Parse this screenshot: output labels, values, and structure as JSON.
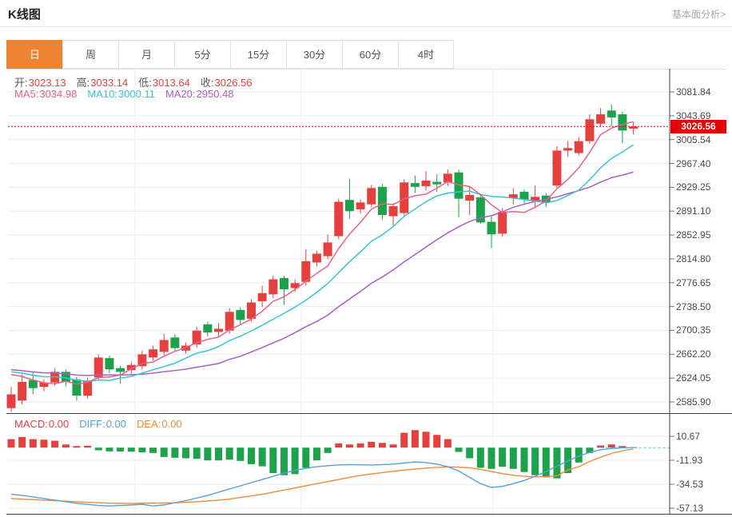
{
  "header": {
    "title": "K线图",
    "link": "基本面分析>"
  },
  "tabs": [
    {
      "label": "日",
      "active": true
    },
    {
      "label": "周",
      "active": false
    },
    {
      "label": "月",
      "active": false
    },
    {
      "label": "5分",
      "active": false
    },
    {
      "label": "15分",
      "active": false
    },
    {
      "label": "30分",
      "active": false
    },
    {
      "label": "60分",
      "active": false
    },
    {
      "label": "4时",
      "active": false
    }
  ],
  "ohlc_legend": [
    {
      "label": "开:",
      "value": "3023.13"
    },
    {
      "label": "高:",
      "value": "3033.14"
    },
    {
      "label": "低:",
      "value": "3013.64"
    },
    {
      "label": "收:",
      "value": "3026.56"
    }
  ],
  "ma_legend": [
    {
      "label": "MA5:",
      "value": "3034.98",
      "color_key": "ma5"
    },
    {
      "label": "MA10:",
      "value": "3000.11",
      "color_key": "ma10"
    },
    {
      "label": "MA20:",
      "value": "2950.48",
      "color_key": "ma20"
    }
  ],
  "macd_legend": [
    {
      "label": "MACD:",
      "value": "0.00",
      "color_key": "up"
    },
    {
      "label": "DIFF:",
      "value": "0.00",
      "color_key": "diff"
    },
    {
      "label": "DEA:",
      "value": "0.00",
      "color_key": "dea"
    }
  ],
  "colors": {
    "up": "#e6403e",
    "down": "#1ba24a",
    "ma5": "#ec5f86",
    "ma10": "#36c6d2",
    "ma20": "#a95fc5",
    "diff": "#57a0d9",
    "dea": "#ec8b3f",
    "badge": "#e60000",
    "tab_active": "#ee8333",
    "grid": "#ececec",
    "frame": "#3f3f3f",
    "tick": "#777777"
  },
  "chart_data": {
    "type": "candlestick",
    "title": "K线图 (日K)",
    "price_axis_labels": [
      "3081.84",
      "3043.69",
      "3005.54",
      "2967.40",
      "2929.25",
      "2891.10",
      "2852.95",
      "2814.80",
      "2776.65",
      "2738.50",
      "2700.35",
      "2662.20",
      "2624.05",
      "2585.90"
    ],
    "price_axis_range": [
      2585.9,
      3081.84
    ],
    "grid": true,
    "legend_position": "top-left",
    "last_price": 3026.56,
    "last_price_label": "3026.56",
    "last_candle": {
      "open": 3023.13,
      "high": 3033.14,
      "low": 3013.64,
      "close": 3026.56
    },
    "ma_values": {
      "ma5": 3034.98,
      "ma10": 3000.11,
      "ma20": 2950.48
    },
    "candles_ohlc": [
      [
        2576,
        2598,
        2570,
        2610
      ],
      [
        2588,
        2618,
        2582,
        2630
      ],
      [
        2621,
        2608,
        2598,
        2633
      ],
      [
        2610,
        2617,
        2603,
        2622
      ],
      [
        2617,
        2634,
        2612,
        2640
      ],
      [
        2634,
        2618,
        2611,
        2638
      ],
      [
        2622,
        2596,
        2588,
        2626
      ],
      [
        2596,
        2620,
        2591,
        2625
      ],
      [
        2625,
        2657,
        2620,
        2662
      ],
      [
        2656,
        2638,
        2632,
        2660
      ],
      [
        2640,
        2634,
        2615,
        2644
      ],
      [
        2637,
        2645,
        2630,
        2650
      ],
      [
        2643,
        2662,
        2638,
        2668
      ],
      [
        2657,
        2670,
        2652,
        2676
      ],
      [
        2666,
        2685,
        2661,
        2695
      ],
      [
        2689,
        2672,
        2667,
        2694
      ],
      [
        2668,
        2676,
        2663,
        2681
      ],
      [
        2678,
        2700,
        2673,
        2706
      ],
      [
        2710,
        2697,
        2691,
        2714
      ],
      [
        2698,
        2703,
        2690,
        2712
      ],
      [
        2700,
        2730,
        2695,
        2736
      ],
      [
        2733,
        2717,
        2710,
        2737
      ],
      [
        2719,
        2745,
        2714,
        2750
      ],
      [
        2747,
        2760,
        2738,
        2772
      ],
      [
        2758,
        2782,
        2752,
        2788
      ],
      [
        2784,
        2766,
        2741,
        2788
      ],
      [
        2768,
        2776,
        2762,
        2782
      ],
      [
        2778,
        2811,
        2772,
        2830
      ],
      [
        2809,
        2823,
        2803,
        2828
      ],
      [
        2819,
        2841,
        2814,
        2854
      ],
      [
        2851,
        2906,
        2846,
        2911
      ],
      [
        2909,
        2891,
        2879,
        2943
      ],
      [
        2894,
        2905,
        2887,
        2910
      ],
      [
        2902,
        2928,
        2897,
        2933
      ],
      [
        2930,
        2885,
        2877,
        2935
      ],
      [
        2883,
        2899,
        2868,
        2904
      ],
      [
        2888,
        2937,
        2883,
        2942
      ],
      [
        2936,
        2930,
        2920,
        2948
      ],
      [
        2931,
        2940,
        2924,
        2955
      ],
      [
        2938,
        2934,
        2922,
        2950
      ],
      [
        2937,
        2951,
        2931,
        2958
      ],
      [
        2953,
        2911,
        2881,
        2957
      ],
      [
        2908,
        2917,
        2885,
        2930
      ],
      [
        2913,
        2873,
        2871,
        2919
      ],
      [
        2874,
        2854,
        2832,
        2884
      ],
      [
        2855,
        2890,
        2850,
        2896
      ],
      [
        2912,
        2918,
        2902,
        2928
      ],
      [
        2922,
        2910,
        2903,
        2926
      ],
      [
        2908,
        2914,
        2896,
        2932
      ],
      [
        2916,
        2905,
        2898,
        2920
      ],
      [
        2932,
        2988,
        2928,
        2995
      ],
      [
        2988,
        2992,
        2978,
        3003
      ],
      [
        2984,
        3003,
        2980,
        3010
      ],
      [
        3003,
        3038,
        2999,
        3046
      ],
      [
        3031,
        3046,
        3027,
        3056
      ],
      [
        3052,
        3041,
        3027,
        3062
      ],
      [
        3046,
        3020,
        3000,
        3050
      ],
      [
        3023.13,
        3026.56,
        3013.64,
        3033.14
      ]
    ],
    "macd": {
      "axis_labels": [
        "10.67",
        "-11.93",
        "-34.53",
        "-57.13"
      ],
      "axis_range": [
        -57.13,
        10.67
      ],
      "current": {
        "macd": 0.0,
        "diff": 0.0,
        "dea": 0.0
      },
      "hist": [
        8,
        10,
        8,
        7.5,
        6.5,
        3,
        1.5,
        1.8,
        -2.5,
        -3.5,
        -3.6,
        -3.8,
        -4.5,
        -5,
        -8.8,
        -9.5,
        -10,
        -10.5,
        -12,
        -12,
        -11.3,
        -12.5,
        -15.6,
        -17.6,
        -24,
        -26,
        -25,
        -19,
        -12,
        -5,
        4,
        3,
        4,
        5.5,
        4.5,
        3,
        14,
        16.5,
        15,
        12,
        8,
        -4,
        -10,
        -19,
        -20,
        -18,
        -20,
        -23,
        -26,
        -28,
        -29,
        -24,
        -14,
        -5,
        2,
        3,
        1.5,
        0.5
      ],
      "diff": [
        -44,
        -45,
        -46.5,
        -48,
        -49.5,
        -51,
        -52.5,
        -53.5,
        -54.5,
        -55,
        -54.5,
        -54,
        -53.5,
        -55,
        -54,
        -52,
        -50,
        -47.5,
        -45,
        -42,
        -39,
        -36,
        -33,
        -30,
        -27,
        -24,
        -21.5,
        -19.5,
        -18,
        -17,
        -16.3,
        -16,
        -16.2,
        -16.5,
        -16,
        -15.5,
        -14.5,
        -13.5,
        -14,
        -15.5,
        -18,
        -22,
        -28,
        -34,
        -37.5,
        -36.5,
        -34,
        -31,
        -27,
        -22.5,
        -17.5,
        -12.5,
        -8,
        -4.5,
        -2,
        -0.8,
        -0.2,
        0
      ],
      "dea": [
        -48,
        -48.5,
        -49,
        -49.5,
        -50,
        -50.5,
        -51,
        -51.5,
        -52,
        -52.3,
        -52.5,
        -52.5,
        -52.4,
        -52.3,
        -52.2,
        -52,
        -51.5,
        -51,
        -50.3,
        -49.5,
        -48.5,
        -47,
        -45.5,
        -44,
        -42,
        -40,
        -38,
        -36,
        -34,
        -32,
        -30,
        -28,
        -26.3,
        -24.8,
        -23.5,
        -22.3,
        -21.2,
        -20.2,
        -19.3,
        -18.6,
        -18.2,
        -18.3,
        -19,
        -20.5,
        -22.5,
        -24.5,
        -26,
        -27,
        -27.5,
        -27.3,
        -26.5,
        -21,
        -18,
        -13,
        -9,
        -5.5,
        -3,
        -1.2
      ]
    }
  }
}
